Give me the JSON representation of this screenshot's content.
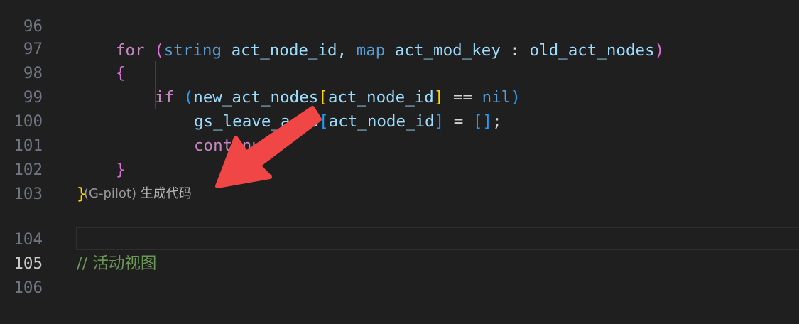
{
  "editor": {
    "line_numbers": [
      "96",
      "97",
      "98",
      "99",
      "100",
      "101",
      "102",
      "103",
      "104",
      "105",
      "106"
    ],
    "lines": {
      "l96": {
        "t1": "for",
        "t2": "(",
        "t3": "string",
        "t4": "act_node_id,",
        "t5": "map",
        "t6": "act_mod_key",
        "t7": ":",
        "t8": "old_act_nodes",
        "t9": ")"
      },
      "l97": {
        "t1": "{"
      },
      "l98": {
        "t1": "if",
        "t2": "(",
        "t3": "new_act_nodes",
        "t4": "[",
        "t5": "act_node_id",
        "t6": "]",
        "t7": "==",
        "t8": "nil",
        "t9": ")"
      },
      "l99": {
        "t1": "gs_leave_acts",
        "t2": "[",
        "t3": "act_node_id",
        "t4": "]",
        "t5": "=",
        "t6": "[]",
        ";": ";"
      },
      "l100": {
        "t1": "continue",
        "t2": ";"
      },
      "l101": {
        "t1": "}"
      },
      "l102": {
        "t1": "}"
      },
      "l104": {
        "t1": "// 活动视图"
      }
    },
    "codelens": {
      "prefix": "(G-pilot)",
      "action": "生成代码"
    },
    "active_line": "105"
  },
  "colors": {
    "background": "#1f1f1f",
    "arrow": "#f04646",
    "keyword": "#569cd6",
    "control": "#c586c0",
    "variable": "#9cdcfe",
    "comment": "#6a9955"
  }
}
